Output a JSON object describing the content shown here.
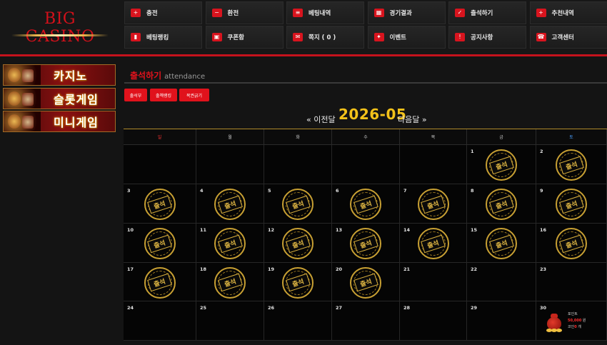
{
  "site": {
    "logo": "BIG CASINO"
  },
  "nav": [
    {
      "label": "충전",
      "icon": "plus-icon",
      "glyph": "+"
    },
    {
      "label": "환전",
      "icon": "minus-icon",
      "glyph": "−"
    },
    {
      "label": "베팅내역",
      "icon": "list-icon",
      "glyph": "≡"
    },
    {
      "label": "경기결과",
      "icon": "calendar-icon",
      "glyph": "▦"
    },
    {
      "label": "출석하기",
      "icon": "check-calendar-icon",
      "glyph": "✓"
    },
    {
      "label": "추천내역",
      "icon": "user-add-icon",
      "glyph": "+"
    },
    {
      "label": "베팅랭킹",
      "icon": "bar-chart-icon",
      "glyph": "▮"
    },
    {
      "label": "쿠폰함",
      "icon": "gift-box-icon",
      "glyph": "▣"
    },
    {
      "label": "쪽지 ( 0 )",
      "icon": "envelope-icon",
      "glyph": "✉"
    },
    {
      "label": "이벤트",
      "icon": "gift-icon",
      "glyph": "✦"
    },
    {
      "label": "공지사항",
      "icon": "info-icon",
      "glyph": "!"
    },
    {
      "label": "고객센터",
      "icon": "phone-icon",
      "glyph": "☎"
    }
  ],
  "sidebar": [
    {
      "label": "카지노"
    },
    {
      "label": "슬롯게임"
    },
    {
      "label": "미니게임"
    }
  ],
  "page": {
    "title": "출석하기",
    "subtitle": "attendance",
    "tabs": [
      "출석부",
      "출첵랭킹",
      "복권긁기"
    ]
  },
  "calendar": {
    "month": "2026-05",
    "prev": "« 이전달",
    "next": "다음달 »",
    "weekdays": [
      {
        "label": "일",
        "color": "#ff3333"
      },
      {
        "label": "월",
        "color": "#cfcfcf"
      },
      {
        "label": "화",
        "color": "#cfcfcf"
      },
      {
        "label": "수",
        "color": "#cfcfcf"
      },
      {
        "label": "목",
        "color": "#cfcfcf"
      },
      {
        "label": "금",
        "color": "#cfcfcf"
      },
      {
        "label": "토",
        "color": "#4aa0ff"
      }
    ],
    "stamp_text": "출석",
    "first_weekday": 5,
    "days": 30,
    "attended": [
      1,
      2,
      3,
      4,
      5,
      6,
      7,
      8,
      9,
      10,
      11,
      12,
      13,
      14,
      15,
      16,
      17,
      18,
      19,
      20
    ],
    "reward": {
      "day": 30,
      "point_label": "포인트",
      "point_value": "50,000 원",
      "coin_label": "코인",
      "coin_value": "0",
      "coin_unit": "개"
    }
  }
}
